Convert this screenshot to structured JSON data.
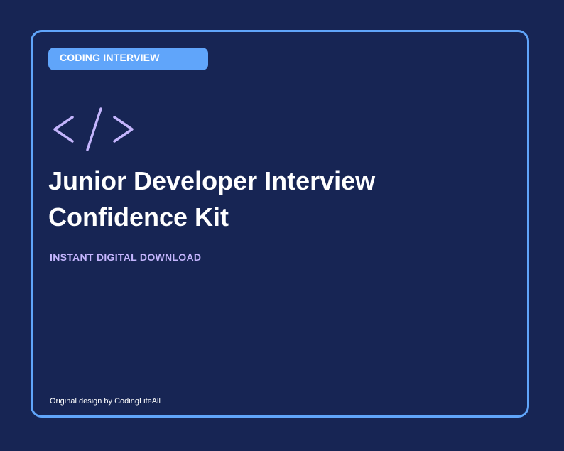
{
  "badge": {
    "label": "CODING INTERVIEW"
  },
  "icon": {
    "name": "code-brackets-icon",
    "color": "#c4b5fd"
  },
  "title": {
    "line1": "Junior Developer Interview",
    "line2": "Confidence Kit"
  },
  "subtitle": "INSTANT DIGITAL DOWNLOAD",
  "footer": "Original design by CodingLifeAll",
  "colors": {
    "background": "#172554",
    "border": "#60a5fa",
    "badge": "#60a5fa",
    "accent": "#c4b5fd",
    "text": "#ffffff"
  }
}
